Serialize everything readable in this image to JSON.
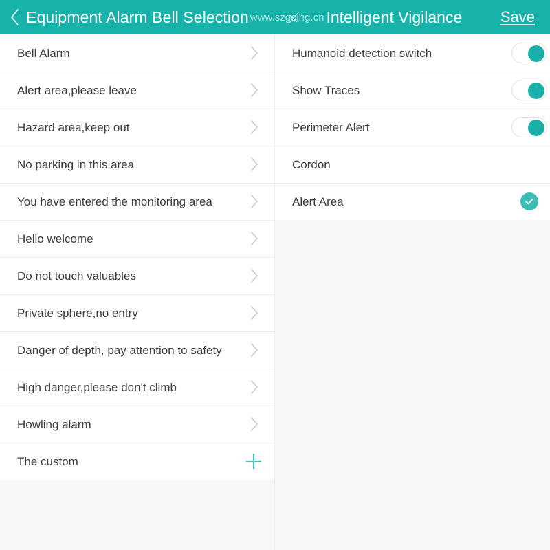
{
  "header": {
    "back_icon": "chevron-left-icon",
    "left_title": "Equipment Alarm Bell Selection",
    "watermark": "www.szgoing.cn",
    "right_title": "Intelligent Vigilance",
    "save_label": "Save",
    "background_color": "#17b2aa",
    "text_color": "#ffffff"
  },
  "colors": {
    "accent": "#17b2aa",
    "toggle_on": "#1aafa8",
    "check_bg": "#3bbdb5",
    "plus": "#45c7c0",
    "row_bg": "#ffffff",
    "page_bg": "#f7f7f7",
    "separator": "#ededed",
    "label": "#3c3c3c",
    "chevron": "#c9c9c9"
  },
  "left_panel": {
    "name": "alarm-bell-list",
    "items": [
      {
        "label": "Bell Alarm",
        "accessory": "chevron-right-icon"
      },
      {
        "label": "Alert area,please leave",
        "accessory": "chevron-right-icon"
      },
      {
        "label": "Hazard area,keep out",
        "accessory": "chevron-right-icon"
      },
      {
        "label": "No parking in this area",
        "accessory": "chevron-right-icon"
      },
      {
        "label": "You have entered the monitoring area",
        "accessory": "chevron-right-icon"
      },
      {
        "label": "Hello welcome",
        "accessory": "chevron-right-icon"
      },
      {
        "label": "Do not touch valuables",
        "accessory": "chevron-right-icon"
      },
      {
        "label": "Private sphere,no entry",
        "accessory": "chevron-right-icon"
      },
      {
        "label": "Danger of depth, pay attention to safety",
        "accessory": "chevron-right-icon"
      },
      {
        "label": "High danger,please don't climb",
        "accessory": "chevron-right-icon"
      },
      {
        "label": "Howling alarm",
        "accessory": "chevron-right-icon"
      },
      {
        "label": "The custom",
        "accessory": "plus-icon"
      }
    ]
  },
  "right_panel": {
    "name": "intelligent-vigilance-settings",
    "items": [
      {
        "label": "Humanoid detection switch",
        "accessory": "toggle",
        "value": "on"
      },
      {
        "label": "Show Traces",
        "accessory": "toggle",
        "value": "on"
      },
      {
        "label": "Perimeter Alert",
        "accessory": "toggle",
        "value": "on"
      },
      {
        "label": "Cordon",
        "accessory": "none",
        "value": ""
      },
      {
        "label": "Alert Area",
        "accessory": "check-circle",
        "value": "selected"
      }
    ]
  }
}
